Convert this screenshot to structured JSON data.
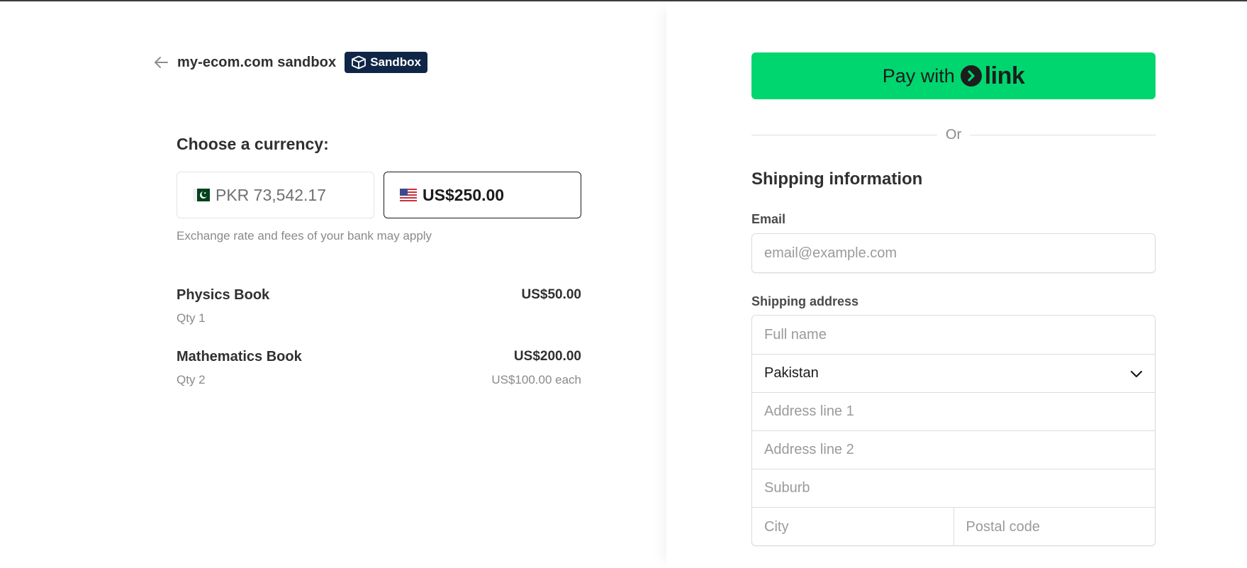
{
  "header": {
    "merchant": "my-ecom.com sandbox",
    "badge": "Sandbox"
  },
  "currency": {
    "title": "Choose a currency:",
    "options": [
      {
        "code": "PKR",
        "amount": "PKR 73,542.17",
        "selected": false
      },
      {
        "code": "USD",
        "amount": "US$250.00",
        "selected": true
      }
    ],
    "note": "Exchange rate and fees of your bank may apply"
  },
  "items": [
    {
      "name": "Physics Book",
      "price": "US$50.00",
      "qty": "Qty 1",
      "each": ""
    },
    {
      "name": "Mathematics Book",
      "price": "US$200.00",
      "qty": "Qty 2",
      "each": "US$100.00 each"
    }
  ],
  "pay": {
    "label": "Pay with",
    "brand": "link",
    "brand_color": "#00d66f"
  },
  "divider": {
    "text": "Or"
  },
  "shipping": {
    "title": "Shipping information",
    "email_label": "Email",
    "email_placeholder": "email@example.com",
    "address_label": "Shipping address",
    "fullname_placeholder": "Full name",
    "country": "Pakistan",
    "address1_placeholder": "Address line 1",
    "address2_placeholder": "Address line 2",
    "suburb_placeholder": "Suburb",
    "city_placeholder": "City",
    "postal_placeholder": "Postal code"
  }
}
